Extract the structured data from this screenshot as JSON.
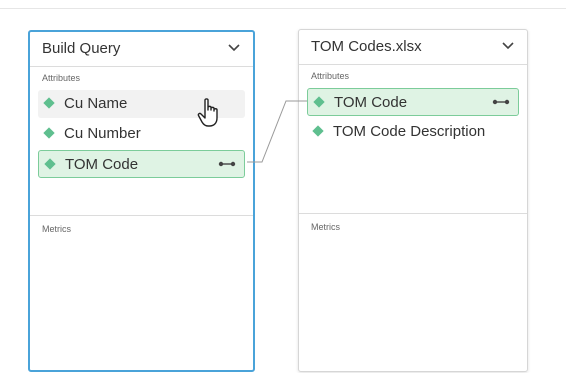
{
  "left_panel": {
    "title": "Build Query",
    "attributes_label": "Attributes",
    "items": [
      {
        "label": "Cu Name"
      },
      {
        "label": "Cu Number"
      },
      {
        "label": "TOM Code"
      }
    ],
    "metrics_label": "Metrics"
  },
  "right_panel": {
    "title": "TOM Codes.xlsx",
    "attributes_label": "Attributes",
    "items": [
      {
        "label": "TOM Code"
      },
      {
        "label": "TOM Code Description"
      }
    ],
    "metrics_label": "Metrics"
  },
  "colors": {
    "active_border": "#4aa3d9",
    "attribute_icon": "#5fbf8f",
    "selected_fill": "#dff3e4",
    "selected_border": "#7ccc9a"
  },
  "icons": [
    "chevron-down-icon",
    "attribute-icon",
    "link-icon",
    "hand-pointer-icon"
  ]
}
